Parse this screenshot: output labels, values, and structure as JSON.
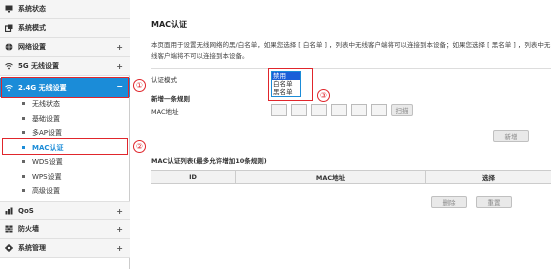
{
  "sidebar": {
    "top_items": [
      {
        "label": "系统状态",
        "icon": "monitor-icon"
      },
      {
        "label": "系统模式",
        "icon": "mode-icon"
      },
      {
        "label": "网络设置",
        "icon": "globe-icon"
      },
      {
        "label": "5G 无线设置",
        "icon": "wifi-icon"
      }
    ],
    "active": {
      "label": "2.4G 无线设置",
      "icon": "wifi-icon"
    },
    "sub_items": [
      "无线状态",
      "基础设置",
      "多AP设置",
      "MAC认证",
      "WDS设置",
      "WPS设置",
      "高级设置"
    ],
    "bottom_items": [
      {
        "label": "QoS",
        "icon": "qos-icon"
      },
      {
        "label": "防火墙",
        "icon": "firewall-icon"
      },
      {
        "label": "系统管理",
        "icon": "gear-icon"
      }
    ],
    "expand_symbol": "+",
    "collapse_symbol": "−"
  },
  "annotations": [
    "①",
    "②",
    "③"
  ],
  "main": {
    "title": "MAC认证",
    "description": "本页面用于设置无线网络的黑/白名单，如果您选择 [ 白名单 ] ，列表中无线客户端将可以连接到本设备；如果您选择 [ 黑名单 ] ，列表中无线客户端将不可以连接到本设备。",
    "auth_mode_label": "认证模式",
    "auth_mode_options": [
      "禁用",
      "白名单",
      "黑名单"
    ],
    "new_rule_label": "新增一条规则",
    "mac_address_label": "MAC地址",
    "scan_button": "扫描",
    "add_button": "新增",
    "list_title": "MAC认证列表(最多允许增加10条规则)",
    "table_headers": [
      "ID",
      "MAC地址",
      "选择"
    ],
    "delete_button": "删除",
    "reset_button": "重置"
  }
}
